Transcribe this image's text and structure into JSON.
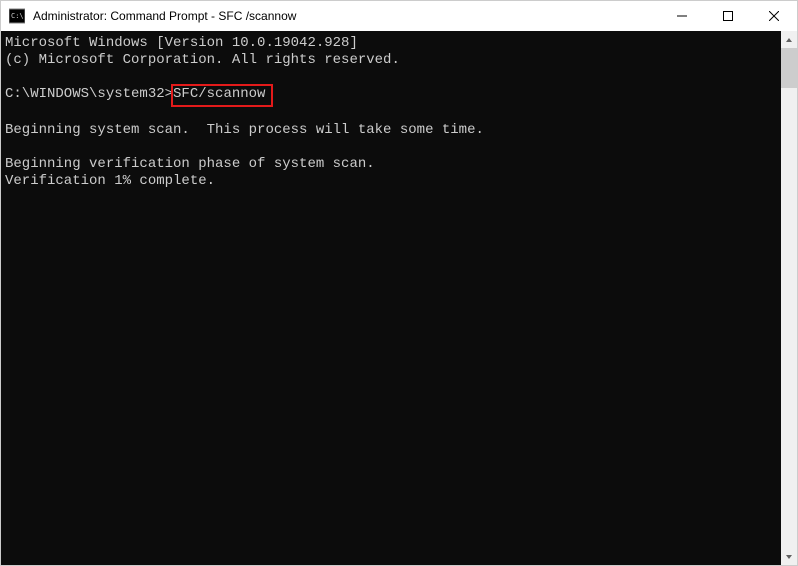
{
  "titlebar": {
    "title": "Administrator: Command Prompt - SFC /scannow",
    "icon": "cmd-icon"
  },
  "window_controls": {
    "minimize": "Minimize",
    "maximize": "Maximize",
    "close": "Close"
  },
  "terminal": {
    "line1": "Microsoft Windows [Version 10.0.19042.928]",
    "line2": "(c) Microsoft Corporation. All rights reserved.",
    "blank1": "",
    "prompt_prefix": "C:\\WINDOWS\\system32>",
    "command": "SFC/scannow",
    "blank2": "",
    "scan_line": "Beginning system scan.  This process will take some time.",
    "blank3": "",
    "verify_line": "Beginning verification phase of system scan.",
    "progress_line": "Verification 1% complete."
  }
}
